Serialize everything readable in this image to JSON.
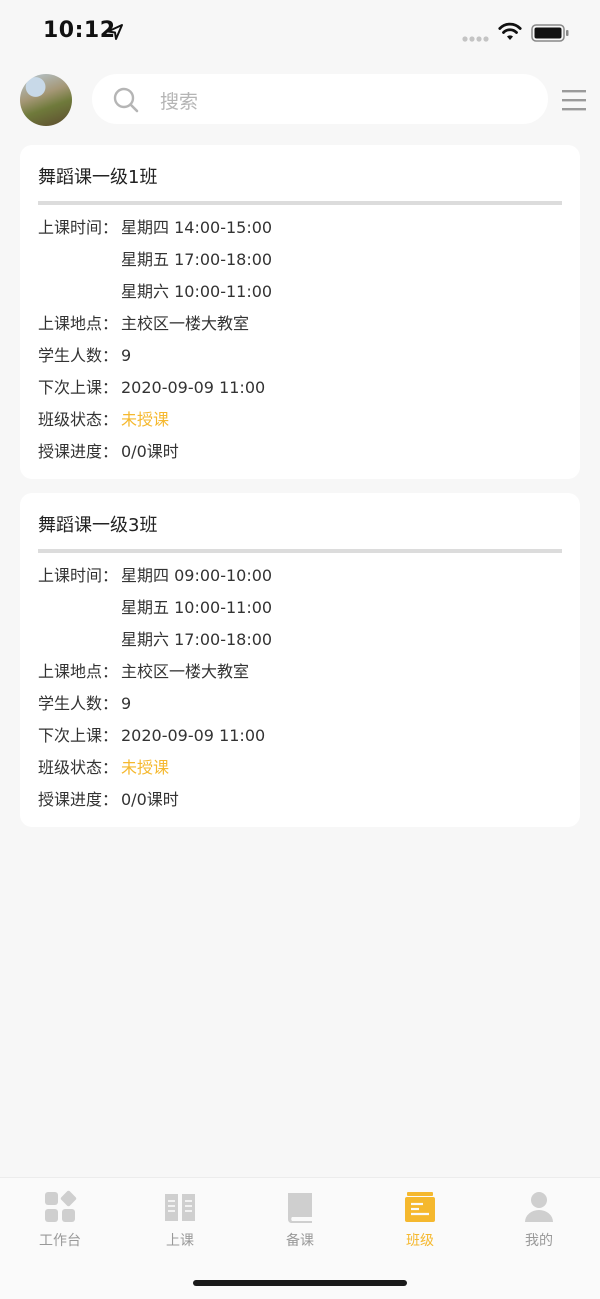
{
  "status_bar": {
    "time": "10:12"
  },
  "header": {
    "search_placeholder": "搜索"
  },
  "classes": [
    {
      "title": "舞蹈课一级1班",
      "schedule_label": "上课时间：",
      "schedule": [
        "星期四 14:00-15:00",
        "星期五 17:00-18:00",
        "星期六 10:00-11:00"
      ],
      "location_label": "上课地点：",
      "location": "主校区一楼大教室",
      "students_label": "学生人数：",
      "students": "9",
      "next_label": "下次上课：",
      "next": "2020-09-09 11:00",
      "status_label": "班级状态：",
      "status": "未授课",
      "progress_label": "授课进度：",
      "progress": "0/0课时"
    },
    {
      "title": "舞蹈课一级3班",
      "schedule_label": "上课时间：",
      "schedule": [
        "星期四 09:00-10:00",
        "星期五 10:00-11:00",
        "星期六 17:00-18:00"
      ],
      "location_label": "上课地点：",
      "location": "主校区一楼大教室",
      "students_label": "学生人数：",
      "students": "9",
      "next_label": "下次上课：",
      "next": "2020-09-09 11:00",
      "status_label": "班级状态：",
      "status": "未授课",
      "progress_label": "授课进度：",
      "progress": "0/0课时"
    }
  ],
  "tabbar": {
    "items": [
      {
        "label": "工作台",
        "icon": "workbench-icon",
        "active": false
      },
      {
        "label": "上课",
        "icon": "open-book-icon",
        "active": false
      },
      {
        "label": "备课",
        "icon": "closed-book-icon",
        "active": false
      },
      {
        "label": "班级",
        "icon": "class-board-icon",
        "active": true
      },
      {
        "label": "我的",
        "icon": "user-icon",
        "active": false
      }
    ]
  },
  "colors": {
    "accent": "#f5b82e",
    "inactive": "#cfcfcf",
    "background": "#f7f7f7"
  }
}
